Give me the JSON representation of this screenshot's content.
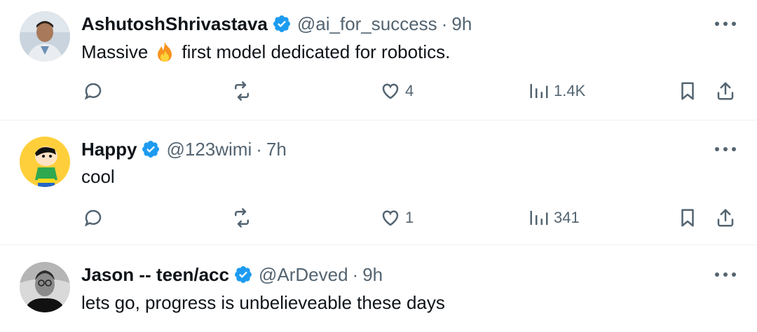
{
  "tweets": [
    {
      "name": "AshutoshShrivastava",
      "handle": "@ai_for_success",
      "separator": "·",
      "time": "9h",
      "text_before": "Massive",
      "emoji": "fire",
      "text_after": "first model dedicated for robotics.",
      "likes": "4",
      "views": "1.4K"
    },
    {
      "name": "Happy",
      "handle": "@123wimi",
      "separator": "·",
      "time": "7h",
      "text": "cool",
      "likes": "1",
      "views": "341"
    },
    {
      "name": "Jason -- teen/acc",
      "handle": "@ArDeved",
      "separator": "·",
      "time": "9h",
      "text": "lets go, progress is unbelieveable these days"
    }
  ],
  "icons": {
    "reply": "reply-icon",
    "retweet": "retweet-icon",
    "like": "heart-icon",
    "views": "views-icon",
    "bookmark": "bookmark-icon",
    "share": "share-icon",
    "verified": "verified-badge-icon",
    "more": "more-icon"
  },
  "colors": {
    "verified": "#1d9bf0",
    "secondary_text": "#536471",
    "primary_text": "#0f1419",
    "divider": "#eff3f4"
  }
}
